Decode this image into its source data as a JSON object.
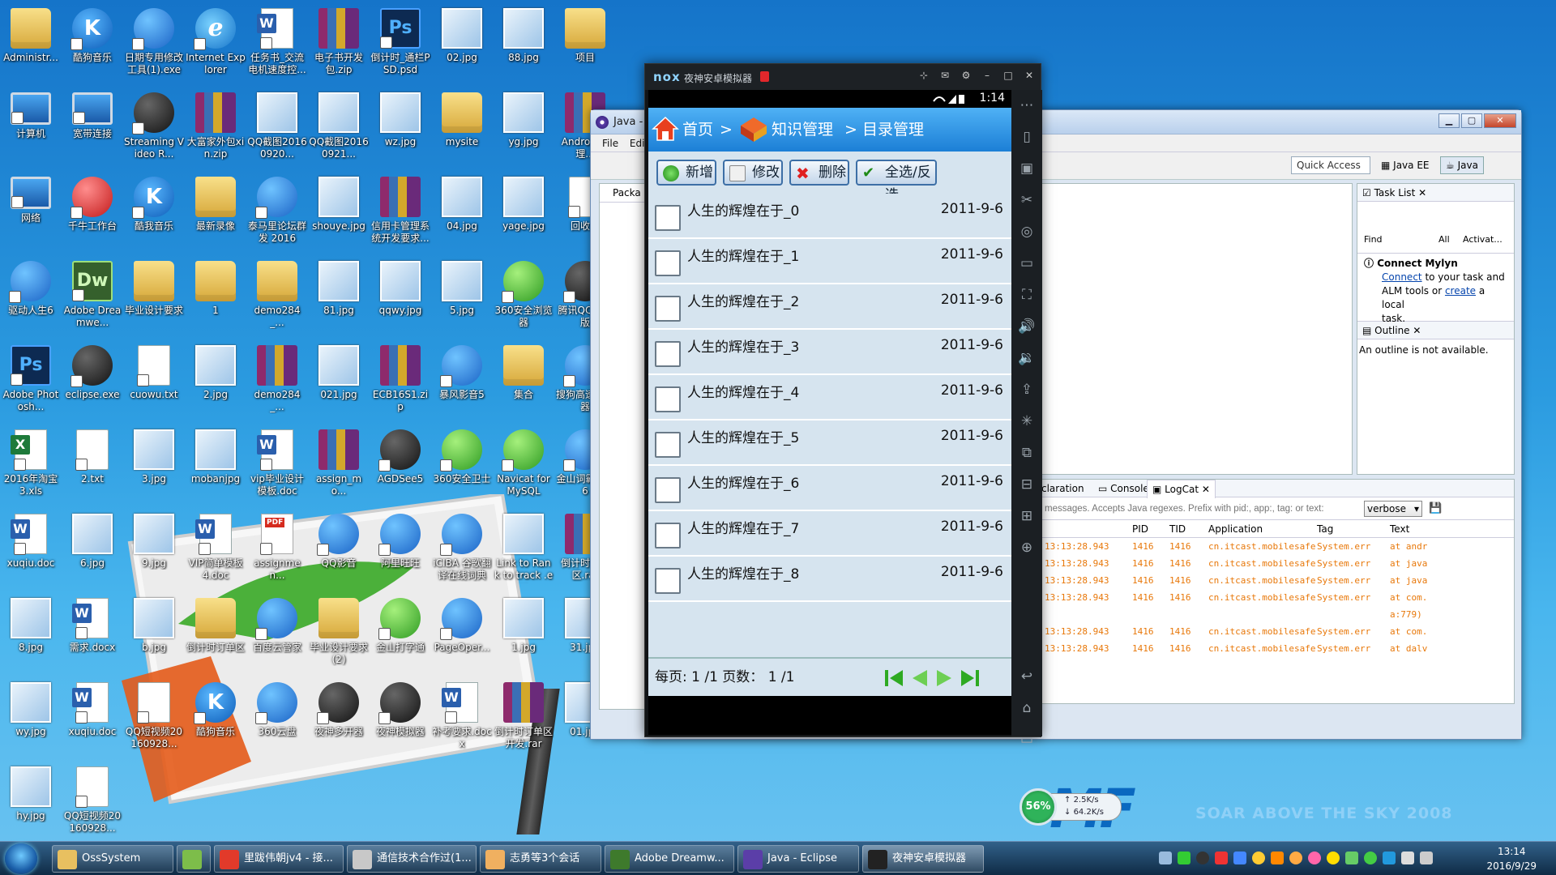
{
  "desktop": {
    "icons": [
      {
        "label": "Administr...",
        "type": "folder"
      },
      {
        "label": "酷狗音乐",
        "type": "k"
      },
      {
        "label": "日期专用修改工具(1).exe",
        "type": "search"
      },
      {
        "label": "Internet Explorer",
        "type": "ie"
      },
      {
        "label": "任务书_交流电机速度控...",
        "type": "word"
      },
      {
        "label": "电子书开发包.zip",
        "type": "rar"
      },
      {
        "label": "倒计时_通栏PSD.psd",
        "type": "ps"
      },
      {
        "label": "02.jpg",
        "type": "img"
      },
      {
        "label": "88.jpg",
        "type": "img"
      },
      {
        "label": "项目",
        "type": "folder"
      },
      {
        "label": "计算机",
        "type": "pc"
      },
      {
        "label": "宽带连接",
        "type": "pc"
      },
      {
        "label": "Streaming Video R...",
        "type": "dark"
      },
      {
        "label": "大富家外包xin.zip",
        "type": "rar"
      },
      {
        "label": "QQ截图20160920...",
        "type": "img"
      },
      {
        "label": "QQ截图20160921...",
        "type": "img"
      },
      {
        "label": "wz.jpg",
        "type": "img"
      },
      {
        "label": "mysite",
        "type": "folder"
      },
      {
        "label": "yg.jpg",
        "type": "img"
      },
      {
        "label": "Android管理...",
        "type": "rar"
      },
      {
        "label": "网络",
        "type": "pc"
      },
      {
        "label": "千牛工作台",
        "type": "red"
      },
      {
        "label": "酷我音乐",
        "type": "k"
      },
      {
        "label": "最新录像",
        "type": "folder"
      },
      {
        "label": "泰马里论坛群发 2016",
        "type": "blue"
      },
      {
        "label": "shouye.jpg",
        "type": "img"
      },
      {
        "label": "信用卡管理系统开发要求...",
        "type": "rar"
      },
      {
        "label": "04.jpg",
        "type": "img"
      },
      {
        "label": "yage.jpg",
        "type": "img"
      },
      {
        "label": "回收站",
        "type": "file"
      },
      {
        "label": "驱动人生6",
        "type": "blue"
      },
      {
        "label": "Adobe Dreamwe...",
        "type": "dw"
      },
      {
        "label": "毕业设计要求",
        "type": "folder"
      },
      {
        "label": "1",
        "type": "folder"
      },
      {
        "label": "demo284_...",
        "type": "folder"
      },
      {
        "label": "81.jpg",
        "type": "img"
      },
      {
        "label": "qqwy.jpg",
        "type": "img"
      },
      {
        "label": "5.jpg",
        "type": "img"
      },
      {
        "label": "360安全浏览器",
        "type": "green"
      },
      {
        "label": "腾讯QQ轻聊版",
        "type": "dark"
      },
      {
        "label": "Adobe Photosh...",
        "type": "ps"
      },
      {
        "label": "eclipse.exe",
        "type": "dark"
      },
      {
        "label": "cuowu.txt",
        "type": "file"
      },
      {
        "label": "2.jpg",
        "type": "img"
      },
      {
        "label": "demo284_...",
        "type": "rar"
      },
      {
        "label": "021.jpg",
        "type": "img"
      },
      {
        "label": "ECB16S1.zip",
        "type": "rar"
      },
      {
        "label": "暴风影音5",
        "type": "blue"
      },
      {
        "label": "集合",
        "type": "folder"
      },
      {
        "label": "搜狗高速浏览器",
        "type": "blue"
      },
      {
        "label": "2016年淘宝3.xls",
        "type": "xls"
      },
      {
        "label": "2.txt",
        "type": "file"
      },
      {
        "label": "3.jpg",
        "type": "img"
      },
      {
        "label": "mobanjpg",
        "type": "img"
      },
      {
        "label": "vip毕业设计模板.doc",
        "type": "word"
      },
      {
        "label": "assign_mo...",
        "type": "rar"
      },
      {
        "label": "AGDSee5",
        "type": "dark"
      },
      {
        "label": "360安全卫士",
        "type": "green"
      },
      {
        "label": "Navicat for MySQL",
        "type": "green"
      },
      {
        "label": "金山词霸2016",
        "type": "blue"
      },
      {
        "label": "xuqiu.doc",
        "type": "word"
      },
      {
        "label": "6.jpg",
        "type": "img"
      },
      {
        "label": "9.jpg",
        "type": "img"
      },
      {
        "label": "VIP简单模板4.doc",
        "type": "word"
      },
      {
        "label": "assignmen...",
        "type": "pdf"
      },
      {
        "label": "QQ影音",
        "type": "blue"
      },
      {
        "label": "阿里旺旺",
        "type": "blue"
      },
      {
        "label": "iCIBA 谷歌翻译在线词典",
        "type": "blue"
      },
      {
        "label": "Link to Rank to track .exe",
        "type": "img"
      },
      {
        "label": "倒计时订单区.rar",
        "type": "rar"
      },
      {
        "label": "8.jpg",
        "type": "img"
      },
      {
        "label": "需求.docx",
        "type": "word"
      },
      {
        "label": "b.jpg",
        "type": "img"
      },
      {
        "label": "倒计时订单区",
        "type": "folder"
      },
      {
        "label": "百度云管家",
        "type": "blue"
      },
      {
        "label": "毕业设计要求(2)",
        "type": "folder"
      },
      {
        "label": "金山打字通",
        "type": "green"
      },
      {
        "label": "PageOper...",
        "type": "blue"
      },
      {
        "label": "1.jpg",
        "type": "img"
      },
      {
        "label": "31.jpg",
        "type": "img"
      },
      {
        "label": "wy.jpg",
        "type": "img"
      },
      {
        "label": "xuqiu.doc",
        "type": "word"
      },
      {
        "label": "QQ短视频20160928...",
        "type": "file"
      },
      {
        "label": "酷狗音乐",
        "type": "k"
      },
      {
        "label": "360云盘",
        "type": "blue"
      },
      {
        "label": "夜神多开器",
        "type": "dark"
      },
      {
        "label": "夜神模拟器",
        "type": "dark"
      },
      {
        "label": "补考要求.docx",
        "type": "word"
      },
      {
        "label": "倒计时订单区开发.rar",
        "type": "rar"
      },
      {
        "label": "01.jpg",
        "type": "img"
      },
      {
        "label": "hy.jpg",
        "type": "img"
      },
      {
        "label": "QQ短视频20160928...",
        "type": "file"
      }
    ],
    "wallpaper_logo": {
      "brand": "MF",
      "slogan": "SOAR ABOVE THE SKY 2008"
    }
  },
  "eclipse": {
    "title": "Java - Eclipse",
    "menu": [
      "File",
      "Edi"
    ],
    "quick_access": "Quick Access",
    "perspectives": [
      "Java EE",
      "Java"
    ],
    "left_panel_tab": "Packa",
    "task_list": {
      "tab": "Task List",
      "find": "Find",
      "all": "All",
      "activate": "Activat..."
    },
    "mylyn": {
      "title": "Connect Mylyn",
      "line1_link": "Connect",
      "line1_rest": " to your task and",
      "line2_pre": "ALM tools or ",
      "line2_link": "create",
      "line2_rest": " a local",
      "line3": "task."
    },
    "outline": {
      "tab": "Outline",
      "message": "An outline is not available."
    },
    "bottom_tabs": [
      "claration",
      "Console",
      "LogCat"
    ],
    "logcat": {
      "filter_placeholder": "messages. Accepts Java regexes. Prefix with pid:, app:, tag: or text:",
      "level": "verbose",
      "columns": [
        "PID",
        "TID",
        "Application",
        "Tag",
        "Text"
      ],
      "rows": [
        {
          "time": "13:13:28.943",
          "pid": "1416",
          "tid": "1416",
          "app": "cn.itcast.mobilesafe",
          "tag": "System.err",
          "text": "at andr"
        },
        {
          "time": "13:13:28.943",
          "pid": "1416",
          "tid": "1416",
          "app": "cn.itcast.mobilesafe",
          "tag": "System.err",
          "text": "at java"
        },
        {
          "time": "13:13:28.943",
          "pid": "1416",
          "tid": "1416",
          "app": "cn.itcast.mobilesafe",
          "tag": "System.err",
          "text": "at java"
        },
        {
          "time": "13:13:28.943",
          "pid": "1416",
          "tid": "1416",
          "app": "cn.itcast.mobilesafe",
          "tag": "System.err",
          "text": "at com."
        },
        {
          "time": "",
          "pid": "",
          "tid": "",
          "app": "",
          "tag": "",
          "text": "a:779)"
        },
        {
          "time": "13:13:28.943",
          "pid": "1416",
          "tid": "1416",
          "app": "cn.itcast.mobilesafe",
          "tag": "System.err",
          "text": "at com."
        },
        {
          "time": "13:13:28.943",
          "pid": "1416",
          "tid": "1416",
          "app": "cn.itcast.mobilesafe",
          "tag": "System.err",
          "text": "at dalv"
        }
      ]
    }
  },
  "nox": {
    "logo": "nox",
    "title": "夜神安卓模拟器",
    "status_time": "1:14",
    "header": {
      "home": "首页",
      "sep1": ">",
      "knowledge": "知识管理",
      "sep2": ">",
      "catalog": "目录管理"
    },
    "buttons": {
      "add": "新增",
      "edit": "修改",
      "delete": "删除",
      "select_all": "全选/反选"
    },
    "rows": [
      {
        "title": "人生的辉煌在于_0",
        "date": "2011-9-6"
      },
      {
        "title": "人生的辉煌在于_1",
        "date": "2011-9-6"
      },
      {
        "title": "人生的辉煌在于_2",
        "date": "2011-9-6"
      },
      {
        "title": "人生的辉煌在于_3",
        "date": "2011-9-6"
      },
      {
        "title": "人生的辉煌在于_4",
        "date": "2011-9-6"
      },
      {
        "title": "人生的辉煌在于_5",
        "date": "2011-9-6"
      },
      {
        "title": "人生的辉煌在于_6",
        "date": "2011-9-6"
      },
      {
        "title": "人生的辉煌在于_7",
        "date": "2011-9-6"
      },
      {
        "title": "人生的辉煌在于_8",
        "date": "2011-9-6"
      }
    ],
    "pager": {
      "text": "每页: 1 /1  页数：  1 /1"
    }
  },
  "net_meter": {
    "percent": "56%",
    "up": "2.5K/s",
    "down": "64.2K/s"
  },
  "taskbar": {
    "items": [
      {
        "label": "OssSystem",
        "color": "#e8c060"
      },
      {
        "label": "",
        "color": "#7dbd4a"
      },
      {
        "label": "里跋伟朝jv4 - 接...",
        "color": "#e23a2a"
      },
      {
        "label": "通信技术合作过(1...",
        "color": "#c8c8c8"
      },
      {
        "label": "志勇等3个会话",
        "color": "#f0b060"
      },
      {
        "label": "Adobe Dreamw...",
        "color": "#3e7a2c"
      },
      {
        "label": "Java - Eclipse",
        "color": "#5b3ea8"
      },
      {
        "label": "夜神安卓模拟器",
        "color": "#222"
      }
    ],
    "time": "13:14",
    "date": "2016/9/29"
  },
  "colors": {
    "accent": "#1c7fd6",
    "row_bg": "#d6e4ef",
    "log_text": "#e8780a"
  }
}
